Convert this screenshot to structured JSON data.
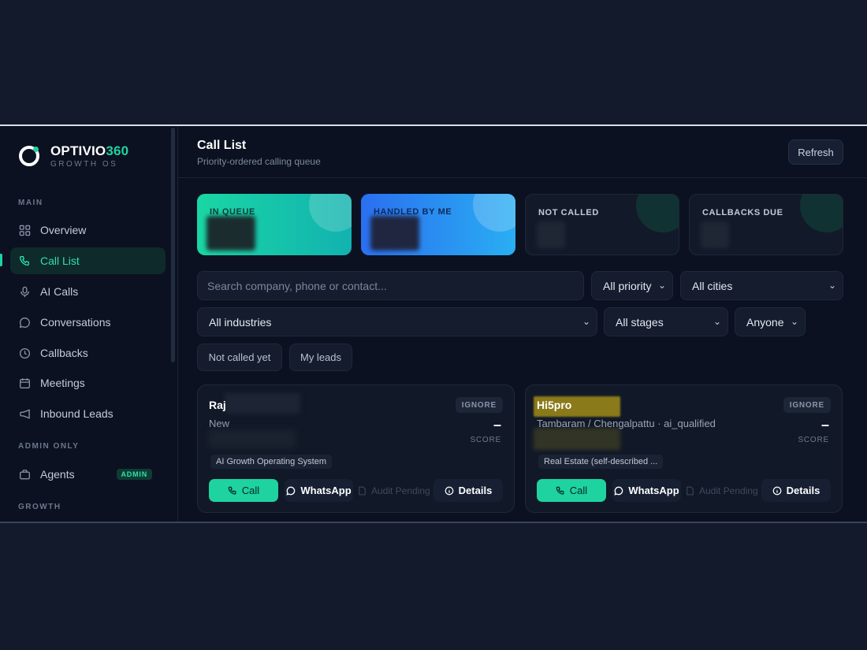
{
  "brand": {
    "name_main": "OPTIVIO",
    "name_accent": "360",
    "tagline": "GROWTH OS"
  },
  "sidebar": {
    "sections": {
      "main": "MAIN",
      "admin": "ADMIN ONLY",
      "growth": "GROWTH"
    },
    "items": [
      {
        "label": "Overview",
        "icon": "grid-icon"
      },
      {
        "label": "Call List",
        "icon": "phone-icon",
        "active": true
      },
      {
        "label": "AI Calls",
        "icon": "microphone-icon"
      },
      {
        "label": "Conversations",
        "icon": "chat-icon"
      },
      {
        "label": "Callbacks",
        "icon": "clock-icon"
      },
      {
        "label": "Meetings",
        "icon": "calendar-icon"
      },
      {
        "label": "Inbound Leads",
        "icon": "megaphone-icon"
      }
    ],
    "admin_items": [
      {
        "label": "Agents",
        "icon": "briefcase-icon",
        "badge": "ADMIN"
      }
    ]
  },
  "header": {
    "title": "Call List",
    "subtitle": "Priority-ordered calling queue",
    "refresh_label": "Refresh"
  },
  "stats": [
    {
      "label": "IN QUEUE"
    },
    {
      "label": "HANDLED BY ME"
    },
    {
      "label": "NOT CALLED"
    },
    {
      "label": "CALLBACKS DUE"
    }
  ],
  "filters": {
    "search_placeholder": "Search company, phone or contact...",
    "priority": "All priority",
    "cities": "All cities",
    "industries": "All industries",
    "stages": "All stages",
    "assignee": "Anyone",
    "chips": [
      "Not called yet",
      "My leads"
    ]
  },
  "leads": [
    {
      "name": "Raj",
      "meta": "New",
      "tag": "AI Growth Operating System",
      "ignore": "IGNORE",
      "score": "–",
      "score_label": "SCORE",
      "actions": {
        "call": "Call",
        "whatsapp": "WhatsApp",
        "audit": "Audit Pending",
        "details": "Details"
      }
    },
    {
      "name": "Hi5pro",
      "meta": "Tambaram / Chengalpattu · ai_qualified",
      "tag": "Real Estate (self-described ...",
      "ignore": "IGNORE",
      "score": "–",
      "score_label": "SCORE",
      "actions": {
        "call": "Call",
        "whatsapp": "WhatsApp",
        "audit": "Audit Pending",
        "details": "Details"
      }
    }
  ],
  "colors": {
    "accent": "#1ed3a0",
    "background": "#0b1120",
    "page": "#131a2c"
  }
}
